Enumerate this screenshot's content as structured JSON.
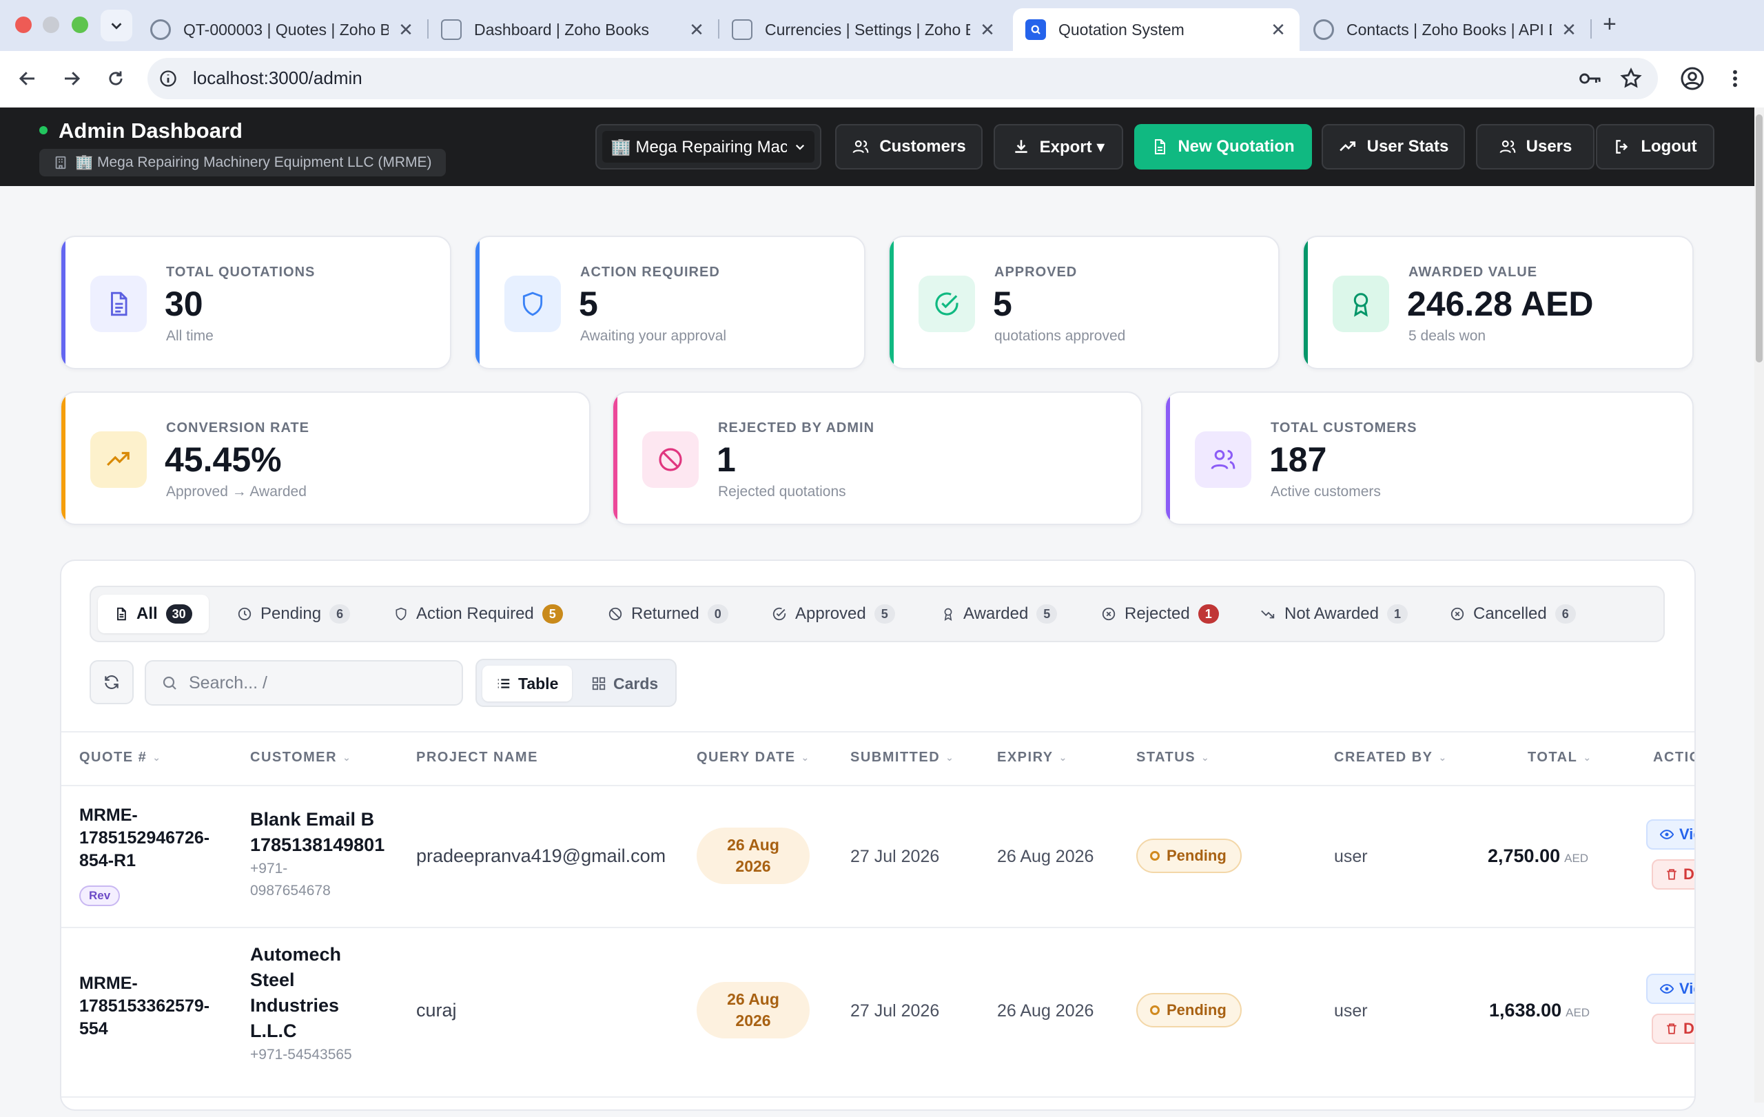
{
  "browser": {
    "tabs": [
      {
        "title": "QT-000003 | Quotes | Zoho B",
        "icon": "zoho-books-icon"
      },
      {
        "title": "Dashboard | Zoho Books",
        "icon": "zoho-books-icon"
      },
      {
        "title": "Currencies | Settings | Zoho B",
        "icon": "zoho-books-icon"
      },
      {
        "title": "Quotation System",
        "icon": "quotation-system-icon"
      },
      {
        "title": "Contacts | Zoho Books | API D",
        "icon": "zoho-books-icon"
      }
    ],
    "url": "localhost:3000/admin"
  },
  "header": {
    "title": "Admin Dashboard",
    "company_chip": "🏢 Mega Repairing Machinery Equipment LLC (MRME)",
    "company_select": "🏢 Mega Repairing Mac",
    "buttons": {
      "customers": "Customers",
      "export": "Export ▾",
      "new_quotation": "New Quotation",
      "user_stats": "User Stats",
      "users": "Users",
      "logout": "Logout"
    }
  },
  "stats": [
    {
      "label": "TOTAL QUOTATIONS",
      "value": "30",
      "sub": "All time",
      "color": "#6366f1",
      "icon": "document-icon"
    },
    {
      "label": "ACTION REQUIRED",
      "value": "5",
      "sub": "Awaiting your approval",
      "color": "#3b82f6",
      "icon": "shield-icon"
    },
    {
      "label": "APPROVED",
      "value": "5",
      "sub": "quotations approved",
      "color": "#10b981",
      "icon": "check-circle-icon"
    },
    {
      "label": "AWARDED VALUE",
      "value": "246.28 AED",
      "sub": "5 deals won",
      "color": "#059669",
      "icon": "award-icon"
    },
    {
      "label": "CONVERSION RATE",
      "value": "45.45%",
      "sub": "Approved → Awarded",
      "color": "#f59e0b",
      "icon": "trending-up-icon"
    },
    {
      "label": "REJECTED BY ADMIN",
      "value": "1",
      "sub": "Rejected quotations",
      "color": "#ec4899",
      "icon": "ban-icon"
    },
    {
      "label": "TOTAL CUSTOMERS",
      "value": "187",
      "sub": "Active customers",
      "color": "#8b5cf6",
      "icon": "users-icon"
    }
  ],
  "filters": [
    {
      "label": "All",
      "count": "30"
    },
    {
      "label": "Pending",
      "count": "6"
    },
    {
      "label": "Action Required",
      "count": "5"
    },
    {
      "label": "Returned",
      "count": "0"
    },
    {
      "label": "Approved",
      "count": "5"
    },
    {
      "label": "Awarded",
      "count": "5"
    },
    {
      "label": "Rejected",
      "count": "1"
    },
    {
      "label": "Not Awarded",
      "count": "1"
    },
    {
      "label": "Cancelled",
      "count": "6"
    }
  ],
  "toolbar": {
    "search_placeholder": "Search...  /",
    "view_table": "Table",
    "view_cards": "Cards"
  },
  "table": {
    "columns": [
      "QUOTE #",
      "CUSTOMER",
      "PROJECT NAME",
      "QUERY DATE",
      "SUBMITTED",
      "EXPIRY",
      "STATUS",
      "CREATED BY",
      "TOTAL",
      "ACTIONS"
    ],
    "rows": [
      {
        "quote_lines": [
          "MRME-",
          "1785152946726-",
          "854-R1"
        ],
        "badge": "Rev",
        "customer_lines": [
          "Blank Email B",
          "1785138149801"
        ],
        "phone_lines": [
          "+971-",
          "0987654678"
        ],
        "project": "pradeepranva419@gmail.com",
        "query_date_lines": [
          "26 Aug",
          "2026"
        ],
        "submitted": "27 Jul 2026",
        "expiry": "26 Aug 2026",
        "status": "Pending",
        "created_by": "user",
        "total": "2,750.00",
        "currency": "AED",
        "view": "View",
        "delete": "Delete"
      },
      {
        "quote_lines": [
          "MRME-",
          "1785153362579-",
          "554"
        ],
        "badge": "",
        "customer_lines": [
          "Automech",
          "Steel",
          "Industries",
          "L.L.C"
        ],
        "phone_lines": [
          "+971-54543565"
        ],
        "project": "curaj",
        "query_date_lines": [
          "26 Aug",
          "2026"
        ],
        "submitted": "27 Jul 2026",
        "expiry": "26 Aug 2026",
        "status": "Pending",
        "created_by": "user",
        "total": "1,638.00",
        "currency": "AED",
        "view": "View",
        "delete": "Delete"
      }
    ]
  }
}
